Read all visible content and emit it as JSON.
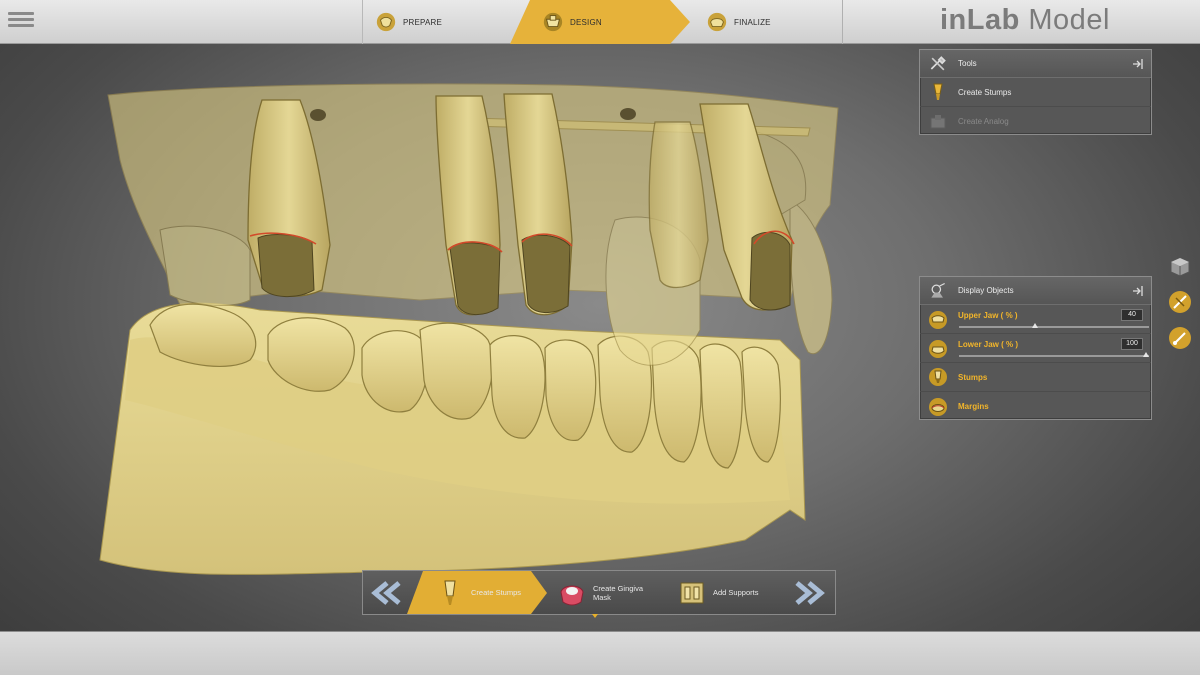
{
  "app": {
    "brand_prefix": "inLab",
    "brand_suffix": " Model"
  },
  "workflow": {
    "steps": [
      {
        "label": "PREPARE",
        "active": false
      },
      {
        "label": "DESIGN",
        "active": true
      },
      {
        "label": "FINALIZE",
        "active": false
      }
    ]
  },
  "tools_panel": {
    "title": "Tools",
    "items": [
      {
        "label": "Create Stumps",
        "enabled": true
      },
      {
        "label": "Create Analog",
        "enabled": false
      }
    ]
  },
  "display_panel": {
    "title": "Display Objects",
    "upper_jaw": {
      "label": "Upper Jaw  ( % )",
      "value": "40",
      "level_percent": 40
    },
    "lower_jaw": {
      "label": "Lower Jaw  ( % )",
      "value": "100",
      "level_percent": 100
    },
    "stumps": {
      "label": "Stumps"
    },
    "margins": {
      "label": "Margins"
    }
  },
  "bottom_toolbar": {
    "items": [
      {
        "label": "Create Stumps",
        "active": true
      },
      {
        "label": "Create Gingiva\nMask",
        "active": false
      },
      {
        "label": "Add Supports",
        "active": false
      }
    ]
  },
  "colors": {
    "accent": "#f2b52a",
    "model": "#e0d08a",
    "panel": "#575757"
  },
  "icons": [
    "menu-icon",
    "prepare-icon",
    "design-icon",
    "finalize-icon",
    "tools-icon",
    "stump-icon",
    "analog-icon",
    "display-objects-icon",
    "upper-jaw-icon",
    "lower-jaw-icon",
    "margins-icon",
    "cube-view-icon",
    "cut-tool-icon",
    "pin-icon",
    "gingiva-icon",
    "supports-icon",
    "prev-arrows-icon",
    "next-arrows-icon"
  ]
}
